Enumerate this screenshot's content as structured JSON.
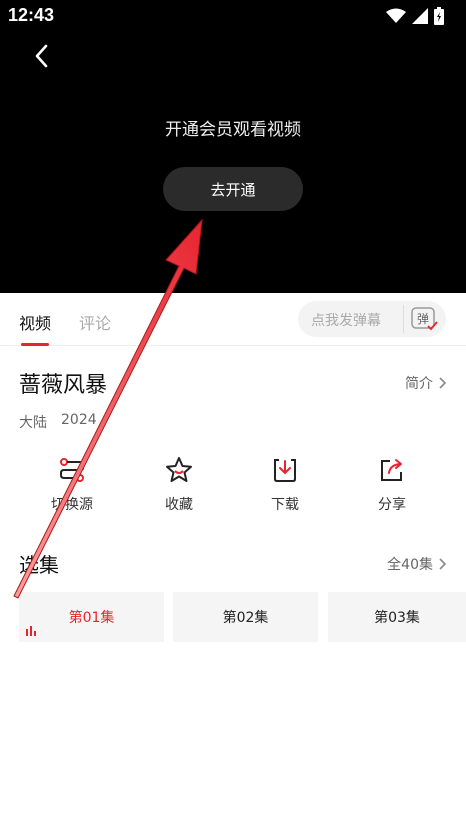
{
  "status": {
    "time": "12:43"
  },
  "player": {
    "vip_text": "开通会员观看视频",
    "vip_button": "去开通"
  },
  "tabs": [
    {
      "label": "视频"
    },
    {
      "label": "评论"
    }
  ],
  "danmaku": {
    "placeholder": "点我发弹幕",
    "icon_label": "弹"
  },
  "show": {
    "title": "蔷薇风暴",
    "intro": "简介",
    "region": "大陆",
    "year": "2024"
  },
  "actions": [
    {
      "label": "切换源",
      "icon": "switch-source-icon"
    },
    {
      "label": "收藏",
      "icon": "star-icon"
    },
    {
      "label": "下载",
      "icon": "download-icon"
    },
    {
      "label": "分享",
      "icon": "share-icon"
    }
  ],
  "episodes": {
    "title": "选集",
    "all": "全40集",
    "items": [
      {
        "label": "第01集",
        "active": true
      },
      {
        "label": "第02集",
        "active": false
      },
      {
        "label": "第03集",
        "active": false
      }
    ]
  },
  "colors": {
    "accent": "#e8242f",
    "player_bg": "#000000"
  }
}
